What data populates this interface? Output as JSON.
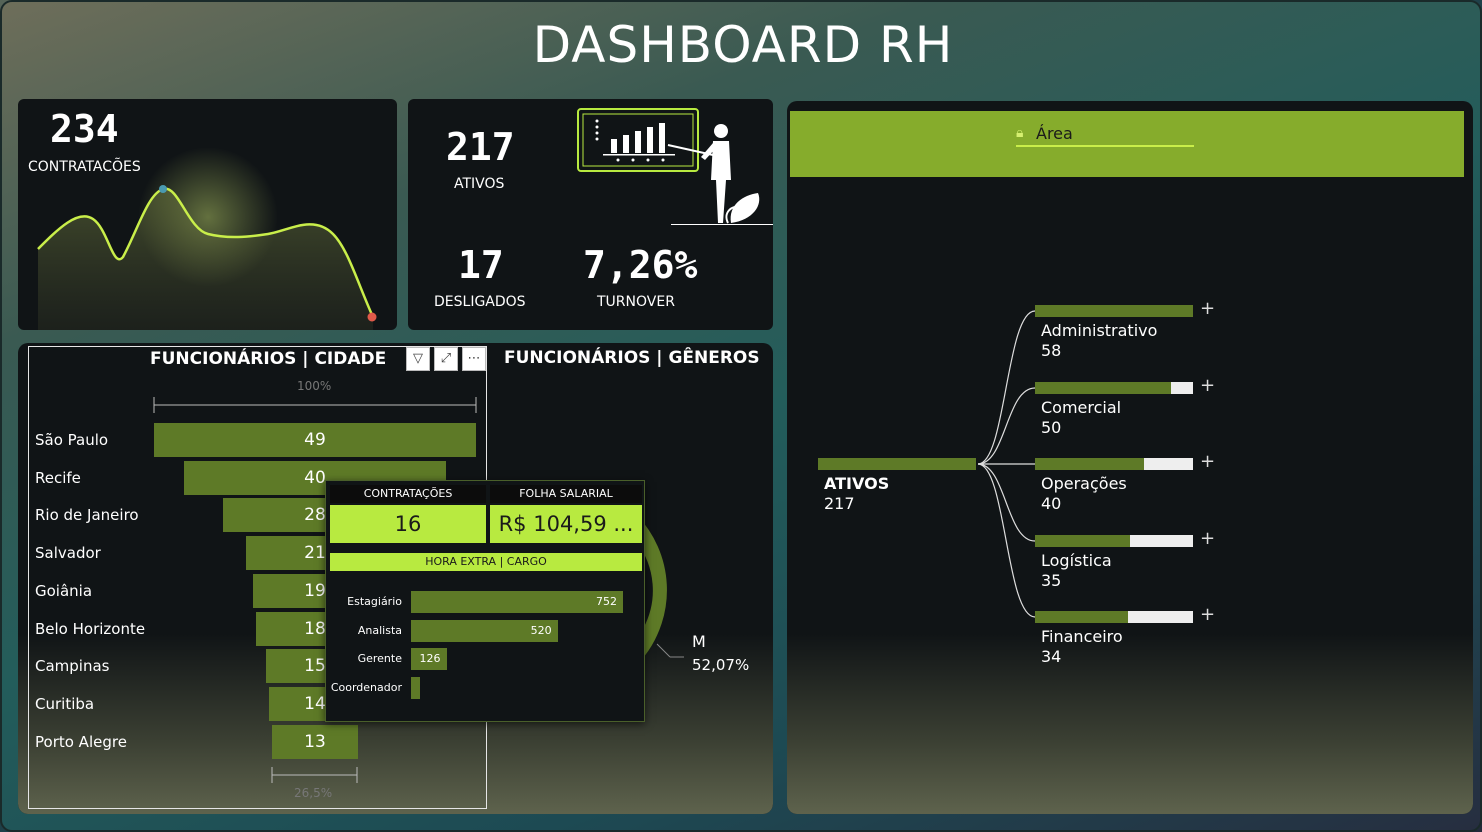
{
  "title": "DASHBOARD RH",
  "kpis": {
    "contratacoes": {
      "value": "234",
      "label": "CONTRATACÕES"
    },
    "ativos": {
      "value": "217",
      "label": "ATIVOS"
    },
    "desligados": {
      "value": "17",
      "label": "DESLIGADOS"
    },
    "turnover": {
      "value": "7,26%",
      "label": "TURNOVER"
    }
  },
  "colors": {
    "accent": "#b8ea40",
    "bar": "#5e7a27",
    "card": "#101416"
  },
  "city_chart": {
    "title": "FUNCIONÁRIOS | CIDADE",
    "top_pct": "100%",
    "bottom_pct": "26,5%",
    "rows": [
      {
        "name": "São Paulo",
        "value": "49",
        "n": 49
      },
      {
        "name": "Recife",
        "value": "40",
        "n": 40
      },
      {
        "name": "Rio de Janeiro",
        "value": "28",
        "n": 28
      },
      {
        "name": "Salvador",
        "value": "21",
        "n": 21
      },
      {
        "name": "Goiânia",
        "value": "19",
        "n": 19
      },
      {
        "name": "Belo Horizonte",
        "value": "18",
        "n": 18
      },
      {
        "name": "Campinas",
        "value": "15",
        "n": 15
      },
      {
        "name": "Curitiba",
        "value": "14",
        "n": 14
      },
      {
        "name": "Porto Alegre",
        "value": "13",
        "n": 13
      }
    ]
  },
  "gender_chart": {
    "title": "FUNCIONÁRIOS | GÊNEROS",
    "m_label": "M",
    "m_pct": "52,07%"
  },
  "tooltip": {
    "contratacoes_label": "CONTRATAÇÕES",
    "contratacoes_value": "16",
    "folha_label": "FOLHA SALARIAL",
    "folha_value": "R$ 104,59 ...",
    "hora_label": "HORA EXTRA | CARGO",
    "bars": [
      {
        "cargo": "Estagiário",
        "value": "752",
        "n": 752
      },
      {
        "cargo": "Analista",
        "value": "520",
        "n": 520
      },
      {
        "cargo": "Gerente",
        "value": "126",
        "n": 126
      },
      {
        "cargo": "Coordenador",
        "value": "",
        "n": 30
      }
    ]
  },
  "tree": {
    "header": "Área",
    "root_label": "ATIVOS",
    "root_value": "217",
    "areas": [
      {
        "name": "Administrativo",
        "value": "58",
        "fill": 1.0
      },
      {
        "name": "Comercial",
        "value": "50",
        "fill": 0.862
      },
      {
        "name": "Operações",
        "value": "40",
        "fill": 0.69
      },
      {
        "name": "Logística",
        "value": "35",
        "fill": 0.603
      },
      {
        "name": "Financeiro",
        "value": "34",
        "fill": 0.586
      }
    ],
    "plus": "+"
  }
}
